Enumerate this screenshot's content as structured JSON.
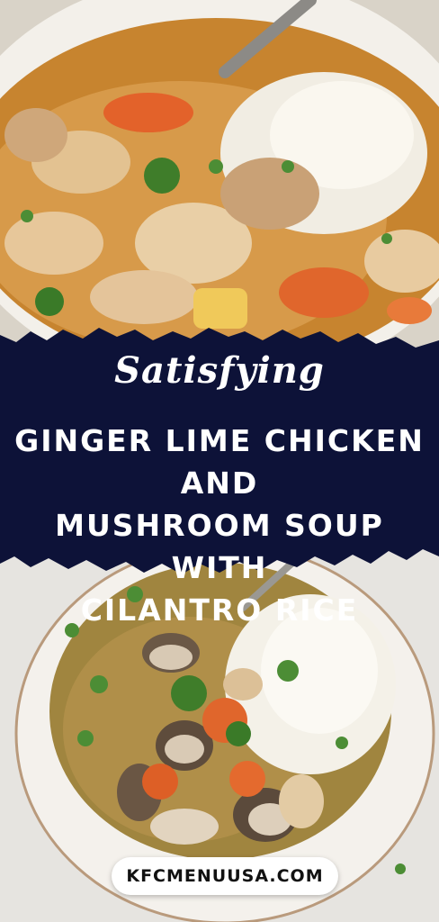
{
  "banner": {
    "subtitle": "Satisfying",
    "title_lines": [
      "GINGER LIME CHICKEN AND",
      "MUSHROOM SOUP WITH",
      "CILANTRO RICE"
    ]
  },
  "website": "KFCMENUUSA.COM",
  "colors": {
    "banner_navy": "#0d1238",
    "broth": "#c98a3c",
    "carrot": "#e0662c",
    "rice": "#f3efe4",
    "herb": "#3f7d2a",
    "bowl": "#f4f1ec"
  }
}
